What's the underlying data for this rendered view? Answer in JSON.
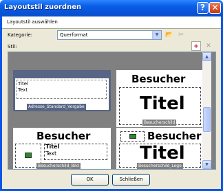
{
  "window": {
    "title": "Layoutstil zuordnen",
    "help_glyph": "?",
    "close_glyph": "✕"
  },
  "header": {
    "text": "Layoutstil auswählen"
  },
  "kategorie": {
    "label": "Kategorie:",
    "value": "Querformat",
    "arrow_glyph": "▼"
  },
  "icons": {
    "folder": "📂",
    "delete_disabled": "✂",
    "add": "+",
    "remove_disabled": "✕"
  },
  "stil": {
    "label": "Stil:"
  },
  "styles": [
    {
      "name": "Adresse_Standard_Vorgabe",
      "line1": "Titel",
      "line2": "Text"
    },
    {
      "name": "Besucherschild",
      "top": "Besucher",
      "big": "Titel"
    },
    {
      "name": "Besucherschild_Bild",
      "top": "Besucher",
      "line1": "Titel",
      "line2": "Text"
    },
    {
      "name": "Besucherschild_Logo",
      "top": "Besucher",
      "big": "Titel"
    }
  ],
  "scroll": {
    "up": "▲",
    "down": "▼"
  },
  "buttons": {
    "ok": "OK",
    "close": "Schließen"
  }
}
